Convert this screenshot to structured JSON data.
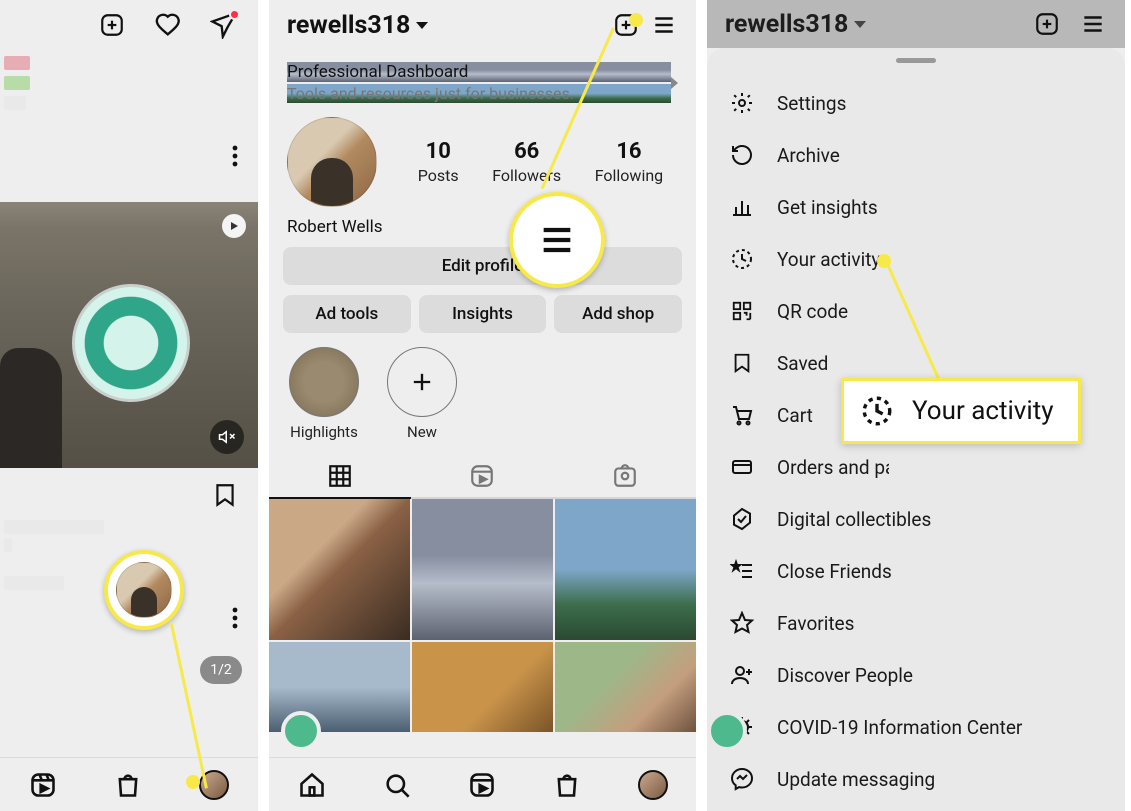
{
  "panel1": {
    "page_indicator": "1/2"
  },
  "panel2": {
    "username": "rewells318",
    "dashboard": {
      "title": "Professional Dashboard",
      "subtitle": "Tools and resources just for businesses."
    },
    "stats": {
      "posts": {
        "n": "10",
        "l": "Posts"
      },
      "followers": {
        "n": "66",
        "l": "Followers"
      },
      "following": {
        "n": "16",
        "l": "Following"
      }
    },
    "full_name": "Robert Wells",
    "buttons": {
      "edit": "Edit profile",
      "adtools": "Ad tools",
      "insights": "Insights",
      "addshop": "Add shop"
    },
    "highlights": {
      "first": "Highlights",
      "new": "New"
    }
  },
  "panel3": {
    "username": "rewells318",
    "menu": {
      "settings": "Settings",
      "archive": "Archive",
      "insights": "Get insights",
      "activity": "Your activity",
      "qr": "QR code",
      "saved": "Saved",
      "cart": "Cart",
      "orders": "Orders and payments",
      "digital": "Digital collectibles",
      "close": "Close Friends",
      "fav": "Favorites",
      "discover": "Discover People",
      "covid": "COVID-19 Information Center",
      "update": "Update messaging"
    },
    "callout": "Your activity"
  }
}
